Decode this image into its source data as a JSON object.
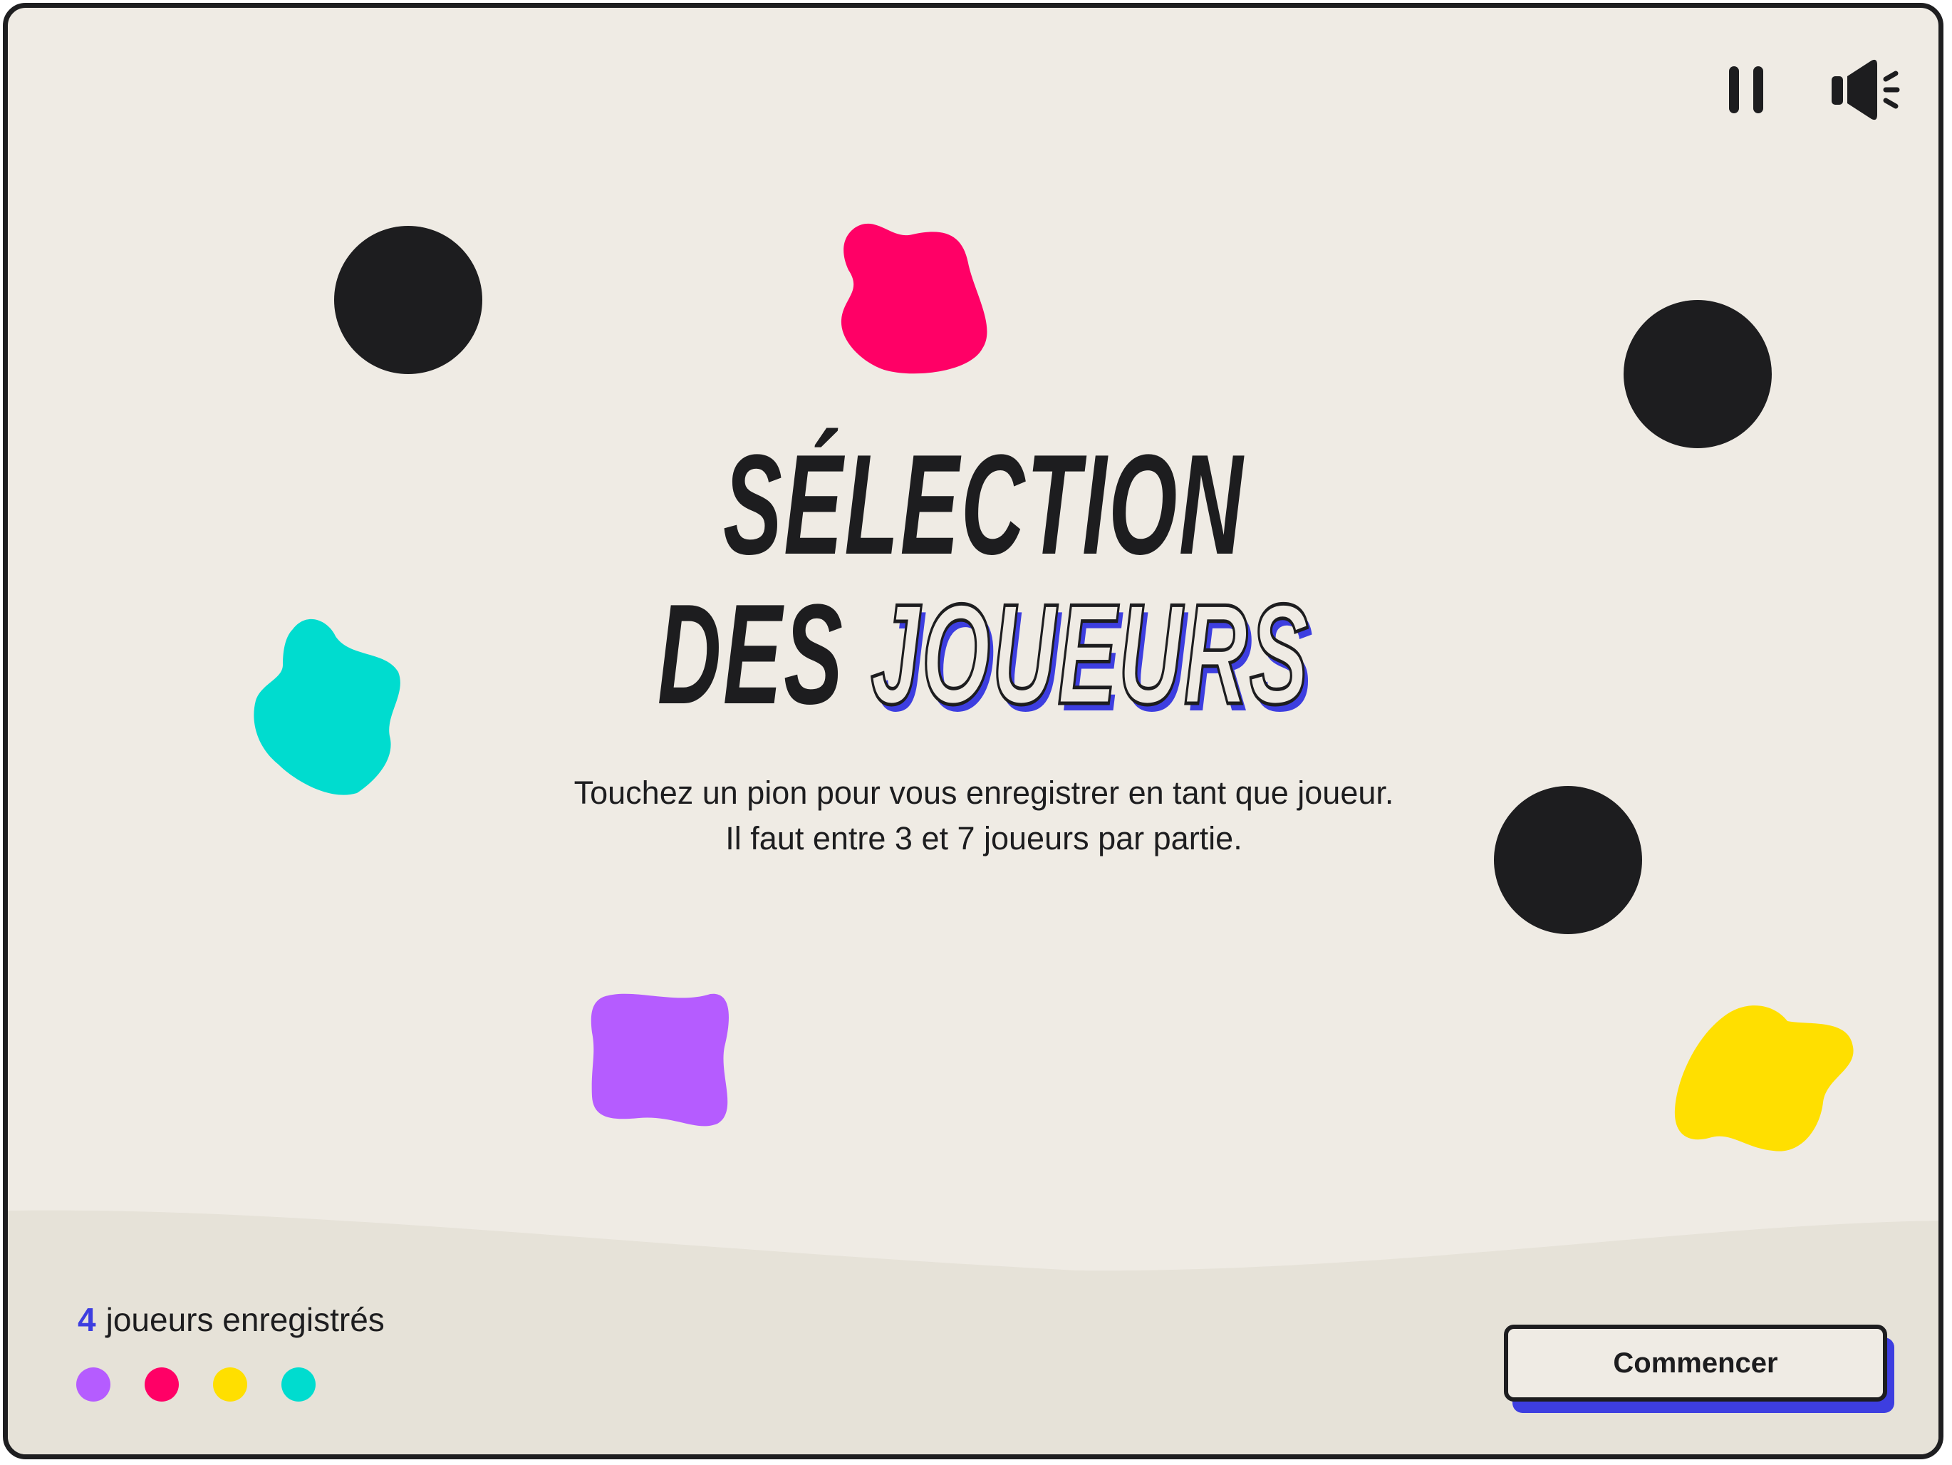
{
  "colors": {
    "background": "#efebe4",
    "ink": "#1d1d1f",
    "accent": "#3d3ee0",
    "bottom_band": "#e6e2d8"
  },
  "controls": {
    "pause_icon": "pause-icon",
    "sound_icon": "speaker-icon"
  },
  "title": {
    "line1": "SÉLECTION",
    "line2_plain": "DES",
    "line2_outline": "JOUEURS"
  },
  "instructions": {
    "line1": "Touchez un pion pour vous enregistrer en tant que joueur.",
    "line2": "Il faut entre 3 et 7 joueurs par partie."
  },
  "pawns": [
    {
      "kind": "empty",
      "color": "#1d1d1f"
    },
    {
      "kind": "registered",
      "color": "#ff0066"
    },
    {
      "kind": "empty",
      "color": "#1d1d1f"
    },
    {
      "kind": "registered",
      "color": "#00dccf"
    },
    {
      "kind": "empty",
      "color": "#1d1d1f"
    },
    {
      "kind": "registered",
      "color": "#b55cff"
    },
    {
      "kind": "registered",
      "color": "#ffdf00"
    }
  ],
  "registered": {
    "count": "4",
    "label": "joueurs enregistrés",
    "player_colors": [
      "#b55cff",
      "#ff0066",
      "#ffdf00",
      "#00dccf"
    ]
  },
  "start_button": {
    "label": "Commencer"
  }
}
